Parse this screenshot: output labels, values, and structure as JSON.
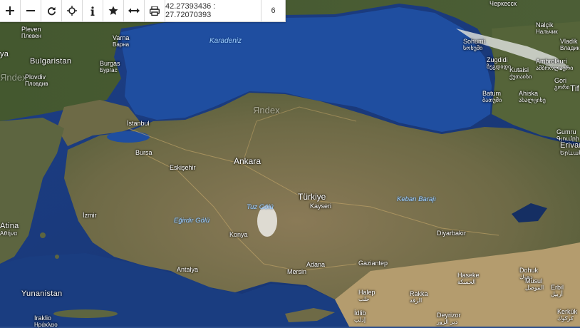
{
  "toolbar": {
    "buttons": [
      {
        "icon": "zoom-in-icon"
      },
      {
        "icon": "zoom-out-icon"
      },
      {
        "icon": "refresh-icon"
      },
      {
        "icon": "locate-icon"
      },
      {
        "icon": "info-icon"
      },
      {
        "icon": "star-icon"
      },
      {
        "icon": "measure-icon"
      },
      {
        "icon": "print-icon"
      }
    ],
    "coordinates": "42.27393436 : 27.72070393",
    "zoom": "6"
  },
  "map": {
    "watermarks": [
      "Яndex",
      "Яndex"
    ],
    "labels": {
      "karadeniz": "Karadeniz",
      "bulgaristan": "Bulgaristan",
      "varna": "Varna",
      "varna_sub": "Варна",
      "burgas": "Burgas",
      "burgas_sub": "Бургас",
      "plovdiv": "Plovdiv",
      "plovdiv_sub": "Пловдив",
      "pleven": "Pleven",
      "pleven_sub": "Плевен",
      "ya": "ya",
      "istanbul": "İstanbul",
      "bursa": "Bursa",
      "eskisehir": "Eskişehir",
      "ankara": "Ankara",
      "turkiye": "Türkiye",
      "kayseri": "Kayseri",
      "tuz_golu": "Tuz Gölü",
      "egirdir_golu": "Eğirdir Gölü",
      "keban_baraji": "Keban Barajı",
      "izmir": "İzmir",
      "atina": "Atina",
      "atina_sub": "Αθήνα",
      "konya": "Konya",
      "antalya": "Antalya",
      "mersin": "Mersin",
      "adana": "Adana",
      "gaziantep": "Gaziantep",
      "diyarbakir": "Diyarbakır",
      "yunanistan": "Yunanistan",
      "sohumi": "Sohumi",
      "sohumi_sub": "სოხუმი",
      "zugdidi": "Zugdidi",
      "zugdidi_sub": "ზუგდიდი",
      "kutaisi": "Kutaisi",
      "kutaisi_sub": "ქუთაისი",
      "ambrolauri": "Ambrolauri",
      "ambrolauri_sub": "ამბროლაური",
      "batum": "Batum",
      "batum_sub": "ბათუმი",
      "ahiska": "Ahiska",
      "ahiska_sub": "ახალციხე",
      "gori": "Gori",
      "gori_sub": "გორი",
      "tif": "Tif",
      "nalcik": "Nalçik",
      "nalcik_sub": "Нальчик",
      "vladik": "Vladik",
      "vladik_sub": "Владик",
      "cherkessk": "Черкесск",
      "gumru": "Gumru",
      "gumru_sub": "Գյումրի",
      "erivan": "Erivan",
      "erivan_sub": "Երևան",
      "dohuk": "Dohuk",
      "dohuk_sub": "دهوك",
      "musul": "Musul",
      "musul_sub": "الموصل",
      "erbil": "Erbil",
      "erbil_sub": "أربيل",
      "kerkuk": "Kerkük",
      "kerkuk_sub": "كركوك",
      "hasice": "Haseke",
      "hasice_sub": "الحسكة",
      "rakka": "Rakka",
      "rakka_sub": "الرقة",
      "halep": "Halep",
      "halep_sub": "حلب",
      "idlib": "İdlib",
      "idlib_sub": "إدلب",
      "deyrizor": "Deyrizor",
      "deyrizor_sub": "دير الزور",
      "iraklio": "Iraklio",
      "iraklio_sub": "Ηράκλειο"
    }
  }
}
